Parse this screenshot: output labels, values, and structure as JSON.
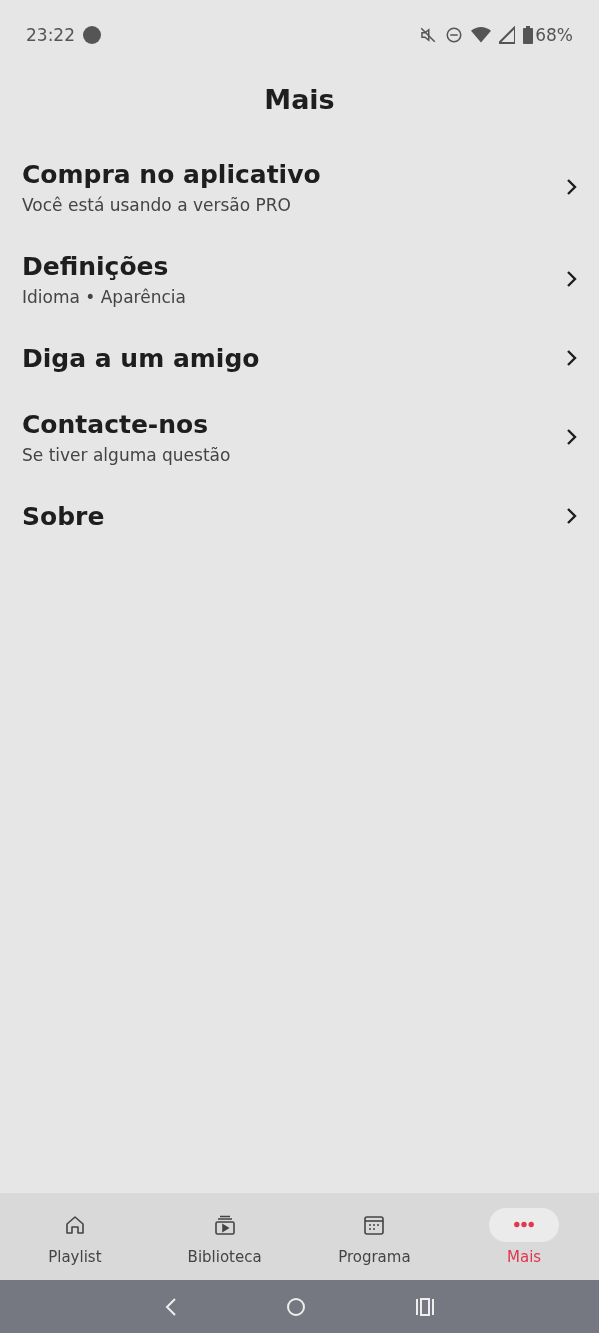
{
  "status_bar": {
    "time": "23:22",
    "battery": "68%"
  },
  "title": "Mais",
  "items": [
    {
      "title": "Compra no aplicativo",
      "subtitle": "Você está usando a versão PRO"
    },
    {
      "title": "Definições",
      "subtitle": "Idioma • Aparência"
    },
    {
      "title": "Diga a um amigo"
    },
    {
      "title": "Contacte-nos",
      "subtitle": "Se tiver alguma questão"
    },
    {
      "title": "Sobre"
    }
  ],
  "tabs": [
    {
      "label": "Playlist",
      "selected": false
    },
    {
      "label": "Biblioteca",
      "selected": false
    },
    {
      "label": "Programa",
      "selected": false
    },
    {
      "label": "Mais",
      "selected": true
    }
  ]
}
